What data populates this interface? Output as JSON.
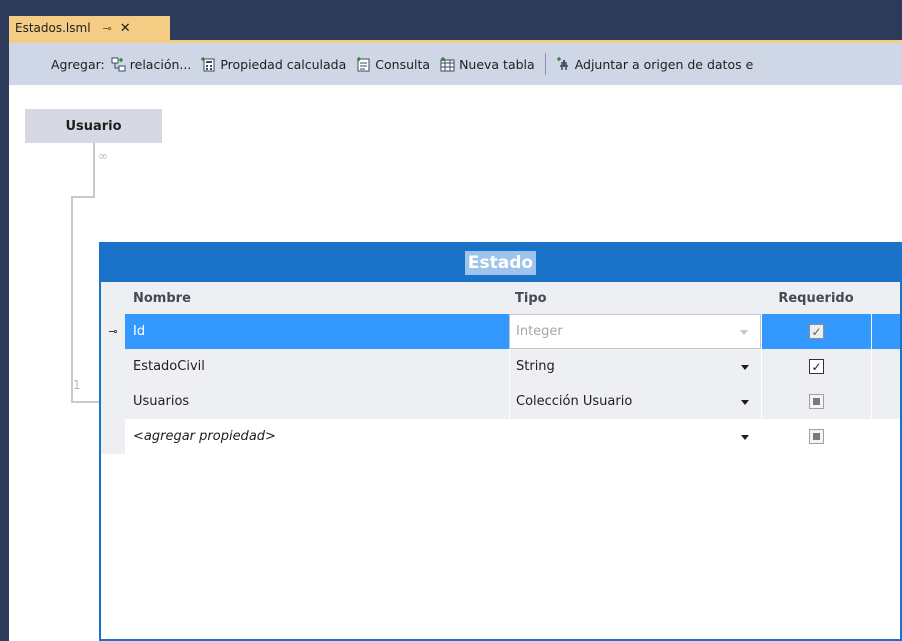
{
  "document_tab": {
    "title": "Estados.lsml",
    "pin_glyph": "⊸",
    "close_glyph": "✕"
  },
  "toolbar": {
    "add_label": "Agregar:",
    "buttons": [
      {
        "label": "relación...",
        "icon": "relationship-icon"
      },
      {
        "label": "Propiedad calculada",
        "icon": "computed-property-icon"
      },
      {
        "label": "Consulta",
        "icon": "query-icon"
      },
      {
        "label": "Nueva tabla",
        "icon": "new-table-icon"
      }
    ],
    "attach_label": "Adjuntar a origen de datos e",
    "attach_icon": "attach-datasource-icon"
  },
  "diagram": {
    "usuario_entity": "Usuario",
    "multiplicity_many": "∞",
    "multiplicity_one": "1",
    "estado_entity": {
      "title": "Estado",
      "columns": {
        "name": "Nombre",
        "type": "Tipo",
        "required": "Requerido"
      },
      "rows": [
        {
          "name": "Id",
          "type": "Integer",
          "required": true,
          "key": true,
          "selected": true,
          "type_disabled": true
        },
        {
          "name": "EstadoCivil",
          "type": "String",
          "required": true
        },
        {
          "name": "Usuarios",
          "type": "Colección Usuario",
          "required": null
        },
        {
          "name": "<agregar propiedad>",
          "type": "",
          "required": null,
          "placeholder": true
        }
      ]
    }
  },
  "colors": {
    "frame": "#2d3b5a",
    "tab_active": "#f5cc84",
    "toolbar_bg": "#cfd6e5",
    "entity_header": "#1a73c8",
    "selection": "#3399ff"
  }
}
